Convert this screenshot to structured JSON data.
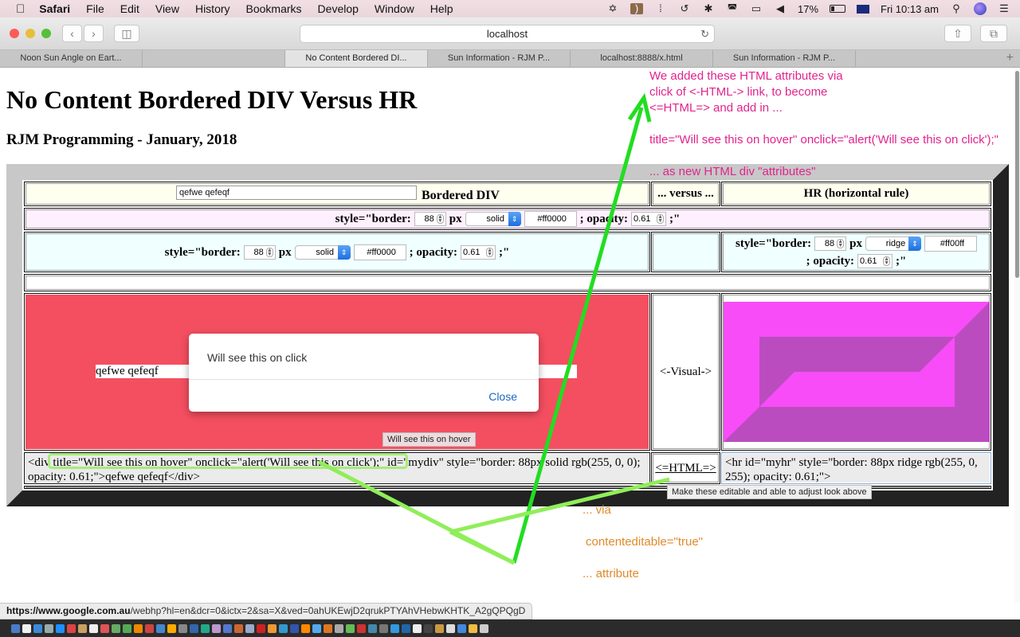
{
  "menubar": {
    "app_name": "Safari",
    "items": [
      "File",
      "Edit",
      "View",
      "History",
      "Bookmarks",
      "Develop",
      "Window",
      "Help"
    ],
    "battery": "17%",
    "clock": "Fri 10:13 am",
    "status_icons": [
      "avast-icon",
      "speaker-app-icon",
      "signal-icon",
      "time-machine-icon",
      "bluetooth-icon",
      "wifi-icon",
      "airplay-icon",
      "volume-icon",
      "battery-icon",
      "flag-au-icon",
      "spotlight-icon",
      "siri-icon",
      "notification-center-icon"
    ]
  },
  "browser": {
    "address": "localhost",
    "tabs": [
      {
        "label": "Noon Sun Angle on Eart...",
        "active": false
      },
      {
        "label": "",
        "active": false
      },
      {
        "label": "No Content Bordered DI...",
        "active": true
      },
      {
        "label": "Sun Information - RJM P...",
        "active": false
      },
      {
        "label": "localhost:8888/x.html",
        "active": false
      },
      {
        "label": "Sun Information - RJM P...",
        "active": false
      }
    ],
    "new_tab": "+",
    "status_url_host": "https://www.google.com.au",
    "status_url_path": "/webhp?hl=en&dcr=0&ictx=2&sa=X&ved=0ahUKEwjD2qrukPTYAhVHebwKHTK_A2gQPQgD"
  },
  "page": {
    "title": "No Content Bordered DIV Versus HR",
    "subtitle": "RJM Programming - January, 2018",
    "header": {
      "textarea_value": "qefwe qefeqf",
      "div_label": "Bordered DIV",
      "versus_label": "... versus ...",
      "hr_label": "HR (horizontal rule)"
    },
    "shared_controls": {
      "prefix": "style=\"border:",
      "width": "88",
      "unit": "px",
      "style": "solid",
      "color": "#ff0000",
      "opacity_label": "; opacity:",
      "opacity": "0.61",
      "suffix": ";\""
    },
    "div_controls": {
      "prefix": "style=\"border:",
      "width": "88",
      "unit": "px",
      "style": "solid",
      "color": "#ff0000",
      "opacity_label": "; opacity:",
      "opacity": "0.61",
      "suffix": ";\""
    },
    "hr_controls": {
      "prefix": "style=\"border:",
      "width": "88",
      "unit": "px",
      "style": "ridge",
      "color": "#ff00ff",
      "opacity_label": "; opacity:",
      "opacity": "0.61",
      "suffix": ";\""
    },
    "visual": {
      "div_content": "qefwe qefeqf",
      "middle_label": "<-Visual->",
      "div_color": "#f44f60",
      "hr_light": "#f84cf8",
      "hr_dark": "#bb4cbf"
    },
    "html_row": {
      "div_html": "<div title=\"Will see this on hover\" onclick=\"alert('Will see this on click');\" id=\"mydiv\" style=\"border: 88px solid rgb(255, 0, 0); opacity: 0.61;\">qefwe qefeqf</div>",
      "middle_link": "<=HTML=>",
      "hr_html": "<hr id=\"myhr\" style=\"border: 88px ridge rgb(255, 0, 255); opacity: 0.61;\">"
    },
    "alert": {
      "message": "Will see this on click",
      "close_label": "Close"
    },
    "tooltips": {
      "hover": "Will see this on hover",
      "html_link": "Make these editable and able to adjust look above"
    }
  },
  "annotations": {
    "pink_lines": [
      "We added these HTML attributes via",
      "click of <-HTML-> link, to become",
      "<=HTML=> and add in ...",
      "",
      "title=\"Will see this on hover\" onclick=\"alert('Will see this on click');\"",
      "",
      "... as new HTML div \"attributes\""
    ],
    "orange_via": "... via",
    "orange_attr": "contenteditable=\"true\"",
    "orange_end": "... attribute",
    "pink_color": "#e0248e",
    "orange_color": "#e08a2a",
    "arrow_green": "#22dd22",
    "arrow_lightgreen": "#90ee5a"
  }
}
